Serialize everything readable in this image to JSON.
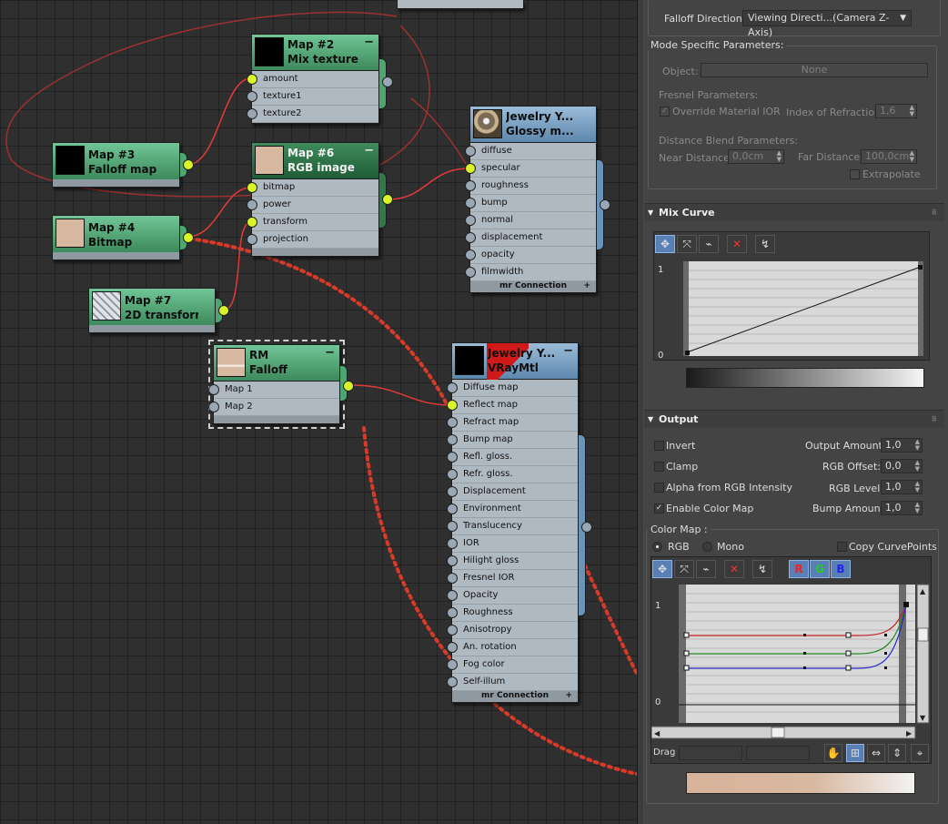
{
  "nodes": {
    "map2": {
      "title1": "Map #2",
      "title2": "Mix texture",
      "slots": [
        "amount",
        "texture1",
        "texture2"
      ]
    },
    "map3": {
      "title1": "Map #3",
      "title2": "Falloff map"
    },
    "map6": {
      "title1": "Map #6",
      "title2": "RGB image",
      "slots": [
        "bitmap",
        "power",
        "transform",
        "projection"
      ]
    },
    "map4": {
      "title1": "Map #4",
      "title2": "Bitmap"
    },
    "map7": {
      "title1": "Map #7",
      "title2": "2D transform..."
    },
    "jewelry_glossy": {
      "title1": "Jewelry Y...",
      "title2": "Glossy m...",
      "slots": [
        "diffuse",
        "specular",
        "roughness",
        "bump",
        "normal",
        "displacement",
        "opacity",
        "filmwidth"
      ],
      "footer": "mr Connection"
    },
    "rm_falloff": {
      "title1": "RM",
      "title2": "Falloff",
      "slots": [
        "Map 1",
        "Map 2"
      ]
    },
    "jewelry_vray": {
      "title1": "Jewelry Y...",
      "title2": "VRayMtl",
      "slots": [
        "Diffuse map",
        "Reflect map",
        "Refract map",
        "Bump map",
        "Refl. gloss.",
        "Refr. gloss.",
        "Displacement",
        "Environment",
        "Translucency",
        "IOR",
        "Hilight gloss",
        "Fresnel IOR",
        "Opacity",
        "Roughness",
        "Anisotropy",
        "An. rotation",
        "Fog color",
        "Self-illum"
      ],
      "footer": "mr Connection"
    },
    "footer_plus": "+",
    "minus": "−"
  },
  "panel": {
    "falloff_direction": {
      "label": "Falloff Direction:",
      "value": "Viewing Directi...(Camera Z-Axis)"
    },
    "mode_specific": {
      "title": "Mode Specific Parameters:",
      "object_label": "Object:",
      "object_value": "None",
      "fresnel_title": "Fresnel Parameters:",
      "override_ior": "Override Material IOR",
      "ior_label": "Index of Refraction",
      "ior_value": "1,6",
      "distance_title": "Distance Blend Parameters:",
      "near_label": "Near Distance:",
      "near_value": "0,0cm",
      "far_label": "Far Distance:",
      "far_value": "100,0cm",
      "extrapolate": "Extrapolate"
    },
    "mix_curve": {
      "title": "Mix Curve",
      "y_top": "1",
      "y_bottom": "0"
    },
    "output": {
      "title": "Output",
      "invert": "Invert",
      "clamp": "Clamp",
      "alpha_from_rgb": "Alpha from RGB Intensity",
      "enable_color_map": "Enable Color Map",
      "output_amount_label": "Output Amount:",
      "output_amount": "1,0",
      "rgb_offset_label": "RGB Offset:",
      "rgb_offset": "0,0",
      "rgb_level_label": "RGB Level:",
      "rgb_level": "1,0",
      "bump_amount_label": "Bump Amount:",
      "bump_amount": "1,0",
      "color_map_label": "Color Map :",
      "rgb": "RGB",
      "mono": "Mono",
      "copy_curve_points": "Copy CurvePoints",
      "r": "R",
      "g": "G",
      "b": "B",
      "y_top": "1",
      "y_bottom": "0",
      "drag": "Drag"
    }
  },
  "colors": {
    "accent_pin": "#d7f52a",
    "wire": "#e23a3a",
    "node_green": "#4fa571",
    "node_blue": "#7aa2c6",
    "skin": "#d7b8a0"
  }
}
